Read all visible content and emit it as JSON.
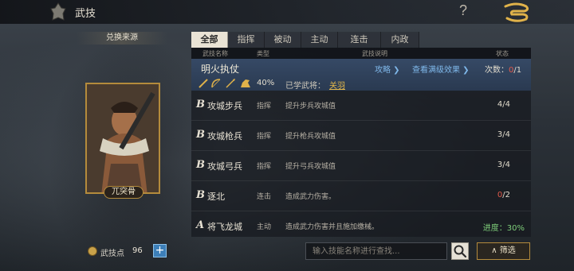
{
  "header": {
    "title": "武技",
    "help": "?"
  },
  "left": {
    "source_button": "兑换来源",
    "general_name": "兀突骨",
    "points_label": "武技点",
    "points_value": "96",
    "add_label": "+"
  },
  "tabs": [
    {
      "label": "全部",
      "active": true
    },
    {
      "label": "指挥",
      "active": false
    },
    {
      "label": "被动",
      "active": false
    },
    {
      "label": "主动",
      "active": false
    },
    {
      "label": "连击",
      "active": false
    },
    {
      "label": "内政",
      "active": false
    }
  ],
  "table": {
    "headers": {
      "name": "武技名称",
      "type": "类型",
      "desc": "武技说明",
      "status": "状态"
    },
    "selected": {
      "name": "明火执仗",
      "strategy_link": "攻略 ❯",
      "max_effect_link": "查看满级效果 ❯",
      "count_label": "次数：",
      "count_current": "0",
      "count_total": "/1",
      "percent": "40%",
      "learned_label": "已学武将：",
      "learned_general": "关羽"
    },
    "rows": [
      {
        "grade": "B",
        "name": "攻城步兵",
        "type": "指挥",
        "desc": "提升步兵攻城值",
        "status": "4/4"
      },
      {
        "grade": "B",
        "name": "攻城枪兵",
        "type": "指挥",
        "desc": "提升枪兵攻城值",
        "status": "3/4"
      },
      {
        "grade": "B",
        "name": "攻城弓兵",
        "type": "指挥",
        "desc": "提升弓兵攻城值",
        "status": "3/4"
      },
      {
        "grade": "B",
        "name": "逐北",
        "type": "连击",
        "desc": "造成武力伤害。",
        "status_red": "0",
        "status_rest": "/2"
      },
      {
        "grade": "A",
        "name": "将飞龙城",
        "type": "主动",
        "desc": "造成武力伤害并且施加缴械。",
        "status": "进度：30%"
      }
    ]
  },
  "search": {
    "placeholder": "输入技能名称进行查找...",
    "filter_label": "∧  筛选"
  },
  "colors": {
    "accent_gold": "#b48b3c",
    "selected_row": "#3a5070",
    "link_blue": "#7fb8ea",
    "warning_red": "#e25a4a",
    "progress_green": "#7fcf7a"
  }
}
